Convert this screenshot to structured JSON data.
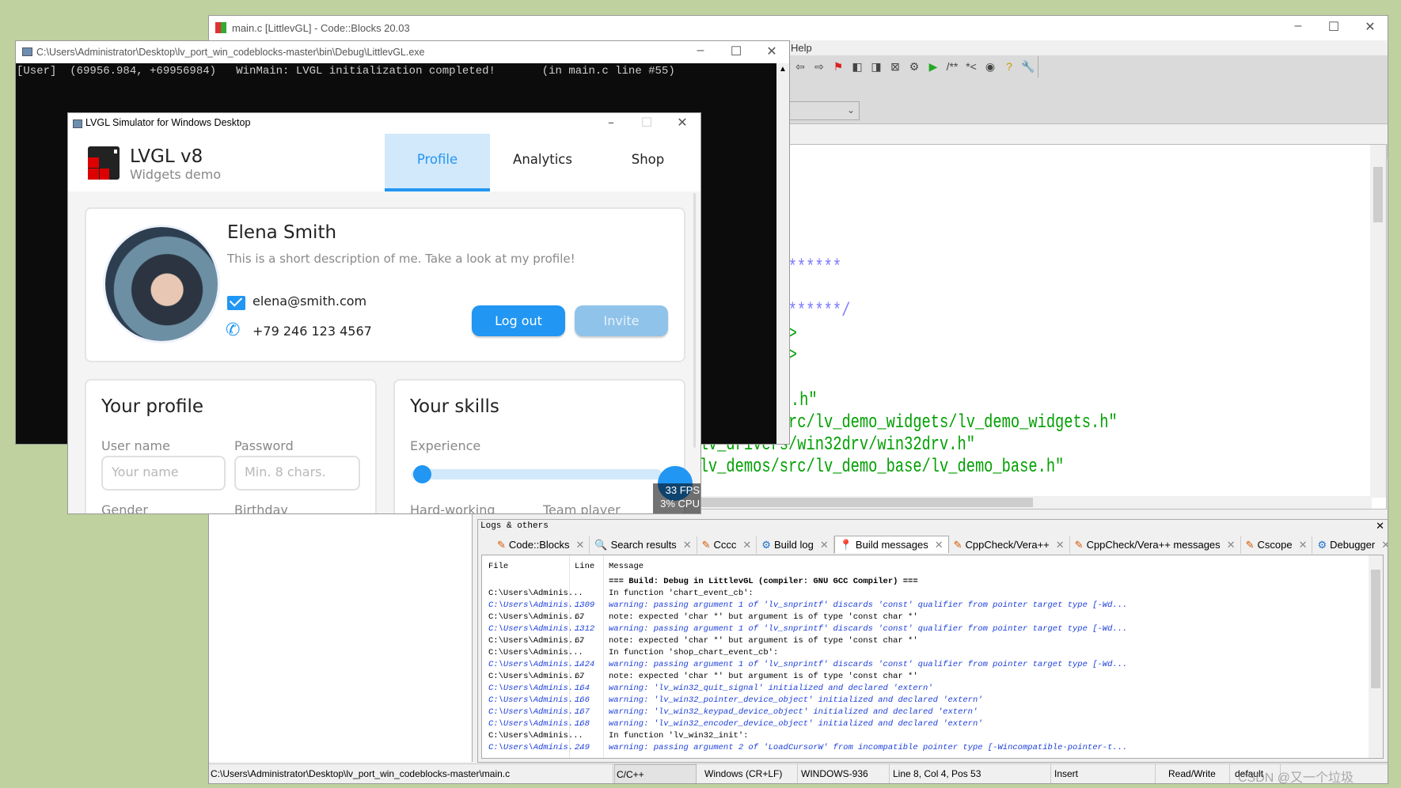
{
  "codeblocks": {
    "title": "main.c [LittlevGL] - Code::Blocks 20.03",
    "menu_visible": "Help",
    "toolbar_icons": [
      "stop-debug-icon",
      "pause-icon",
      "abort-icon",
      "debug-windows-icon",
      "info-icon",
      "back-icon",
      "forward-icon",
      "bookmark-toggle-icon",
      "bookmark-prev-icon",
      "bookmark-next-icon",
      "bookmark-clear-icon",
      "build-icon",
      "run-icon",
      "doxy-comment-icon",
      "doxy-inline-icon",
      "doxywizard-icon",
      "help-icon",
      "settings-icon"
    ],
    "doxy_labels": [
      "/**",
      "*<"
    ],
    "code_fragments_right": [
      "*********",
      "ES",
      "*********/",
      "o.h>",
      "d.h>",
      "",
      "lvgl.h\""
    ],
    "code_fragments_left": [
      "e \"lv_demos/src/lv_demo_widgets/lv_demo_widgets.h\"",
      "e \"lv_drivers/win32drv/win32drv.h\"",
      "e \"lv_demos/src/lv_demo_base/lv_demo_base.h\""
    ],
    "colors": {
      "comment": "#7b7bff",
      "include": "#00a000",
      "bg_desktop": "#bed19e"
    }
  },
  "console": {
    "title": "C:\\Users\\Administrator\\Desktop\\lv_port_win_codeblocks-master\\bin\\Debug\\LittlevGL.exe",
    "line": "[User]  (69956.984, +69956984)   WinMain: LVGL initialization completed!       (in main.c line #55)"
  },
  "lvgl": {
    "window_title": "LVGL Simulator for Windows Desktop",
    "logo_title": "LVGL v8",
    "logo_subtitle": "Widgets demo",
    "tabs": [
      {
        "label": "Profile",
        "active": true
      },
      {
        "label": "Analytics"
      },
      {
        "label": "Shop"
      }
    ],
    "profile": {
      "name": "Elena Smith",
      "description": "This is a short description of me. Take a look at my profile!",
      "email": "elena@smith.com",
      "phone": "+79 246 123 4567",
      "logout": "Log out",
      "invite": "Invite"
    },
    "your_profile": {
      "title": "Your profile",
      "username_label": "User name",
      "username_placeholder": "Your name",
      "password_label": "Password",
      "password_placeholder": "Min. 8 chars.",
      "gender_label": "Gender",
      "birthday_label": "Birthday"
    },
    "your_skills": {
      "title": "Your skills",
      "experience_label": "Experience",
      "experience_percent": 2,
      "hard_working_label": "Hard-working",
      "team_player_label": "Team player"
    },
    "perf": {
      "fps": "33 FPS",
      "cpu": "3% CPU"
    },
    "accent": "#2196f3"
  },
  "logs": {
    "title": "Logs & others",
    "tabs": [
      {
        "label": "Code::Blocks",
        "icon": "pencil-icon"
      },
      {
        "label": "Search results",
        "icon": "search-icon"
      },
      {
        "label": "Cccc",
        "icon": "pencil-icon"
      },
      {
        "label": "Build log",
        "icon": "gear-icon"
      },
      {
        "label": "Build messages",
        "icon": "pin-icon",
        "active": true
      },
      {
        "label": "CppCheck/Vera++",
        "icon": "pencil-icon"
      },
      {
        "label": "CppCheck/Vera++ messages",
        "icon": "pencil-icon"
      },
      {
        "label": "Cscope",
        "icon": "pencil-icon"
      },
      {
        "label": "Debugger",
        "icon": "gear-icon"
      }
    ],
    "columns": [
      "File",
      "Line",
      "Message"
    ],
    "rows": [
      {
        "file": "",
        "line": "",
        "msg": "=== Build: Debug in LittlevGL (compiler: GNU GCC Compiler) ===",
        "type": "header"
      },
      {
        "file": "C:\\Users\\Adminis...",
        "line": "",
        "msg": "In function 'chart_event_cb':",
        "type": "note"
      },
      {
        "file": "C:\\Users\\Adminis...",
        "line": "1309",
        "msg": "warning: passing argument 1 of 'lv_snprintf' discards 'const' qualifier from pointer target type [-Wd...",
        "type": "warn"
      },
      {
        "file": "C:\\Users\\Adminis...",
        "line": "67",
        "msg": "note: expected 'char *' but argument is of type 'const char *'",
        "type": "note"
      },
      {
        "file": "C:\\Users\\Adminis...",
        "line": "1312",
        "msg": "warning: passing argument 1 of 'lv_snprintf' discards 'const' qualifier from pointer target type [-Wd...",
        "type": "warn"
      },
      {
        "file": "C:\\Users\\Adminis...",
        "line": "67",
        "msg": "note: expected 'char *' but argument is of type 'const char *'",
        "type": "note"
      },
      {
        "file": "C:\\Users\\Adminis...",
        "line": "",
        "msg": "In function 'shop_chart_event_cb':",
        "type": "note"
      },
      {
        "file": "C:\\Users\\Adminis...",
        "line": "1424",
        "msg": "warning: passing argument 1 of 'lv_snprintf' discards 'const' qualifier from pointer target type [-Wd...",
        "type": "warn"
      },
      {
        "file": "C:\\Users\\Adminis...",
        "line": "67",
        "msg": "note: expected 'char *' but argument is of type 'const char *'",
        "type": "note"
      },
      {
        "file": "C:\\Users\\Adminis...",
        "line": "164",
        "msg": "warning: 'lv_win32_quit_signal' initialized and declared 'extern'",
        "type": "warn"
      },
      {
        "file": "C:\\Users\\Adminis...",
        "line": "166",
        "msg": "warning: 'lv_win32_pointer_device_object' initialized and declared 'extern'",
        "type": "warn"
      },
      {
        "file": "C:\\Users\\Adminis...",
        "line": "167",
        "msg": "warning: 'lv_win32_keypad_device_object' initialized and declared 'extern'",
        "type": "warn"
      },
      {
        "file": "C:\\Users\\Adminis...",
        "line": "168",
        "msg": "warning: 'lv_win32_encoder_device_object' initialized and declared 'extern'",
        "type": "warn"
      },
      {
        "file": "C:\\Users\\Adminis...",
        "line": "",
        "msg": "In function 'lv_win32_init':",
        "type": "note"
      },
      {
        "file": "C:\\Users\\Adminis...",
        "line": "249",
        "msg": "warning: passing argument 2 of 'LoadCursorW' from incompatible pointer type [-Wincompatible-pointer-t...",
        "type": "warn"
      }
    ]
  },
  "statusbar": {
    "path": "C:\\Users\\Administrator\\Desktop\\lv_port_win_codeblocks-master\\main.c",
    "language": "C/C++",
    "eol": "Windows (CR+LF)",
    "encoding": "WINDOWS-936",
    "position": "Line 8, Col 4, Pos 53",
    "mode": "Insert",
    "access": "Read/Write",
    "profile": "default",
    "watermark": "CSDN @又一个垃圾"
  }
}
